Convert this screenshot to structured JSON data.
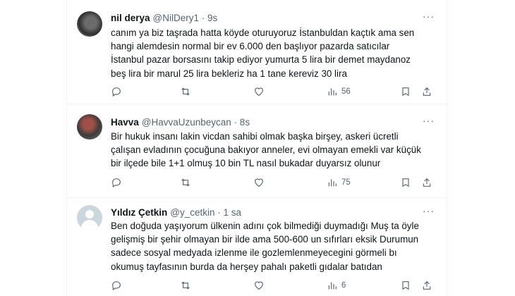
{
  "tweets": [
    {
      "name": "nil derya",
      "handle": "@NilDery1 · 9s",
      "text": "canım ya biz taşrada hatta köyde oturuyoruz İstanbuldan kaçtık ama sen\nhangi alemdesin  normal bir ev 6.000 den başlıyor pazarda satıcılar\nİstanbul pazar borsasını takip ediyor yumurta 5 lira bir demet maydanoz\nbeş lira bir marul 25 lira bekleriz  ha 1 tane kereviz 30 lira",
      "views": "56"
    },
    {
      "name": "Havva",
      "handle": "@HavvaUzunbeycan · 8s",
      "text": "Bir hukuk insanı lakin vicdan sahibi olmak başka birşey, askeri ücretli\nçalışan evladının çocuğuna bakıyor anneler, evi olmayan emekli var küçük\nbir ilçede bile 1+1 olmuş 10 bin TL nasıl bukadar duyarsız olunur",
      "views": "75"
    },
    {
      "name": "Yıldız Çetkin",
      "handle": "@y_cetkin · 1 sa",
      "text": "Ben doğuda yaşıyorum ülkenin adını çok bilmediği duymadığı Muş ta öyle\ngelişmiş bir şehir olmayan bir ilde ama 500-600 un sıfırları eksik Durumun\nsadece sosyal medyada izlenme ile gozlemlenmeyecegini görmeli bı\nokumuş tayfasının burda da herşey pahalı paketli gıdalar batıdan",
      "views": "6"
    }
  ],
  "icons": {
    "more": "more-icon",
    "reply": "reply-icon",
    "retweet": "retweet-icon",
    "like": "like-icon",
    "views": "views-icon",
    "bookmark": "bookmark-icon",
    "share": "share-icon"
  },
  "colors": {
    "text": "#0f1419",
    "secondary": "#536471",
    "border": "#eff3f4"
  }
}
